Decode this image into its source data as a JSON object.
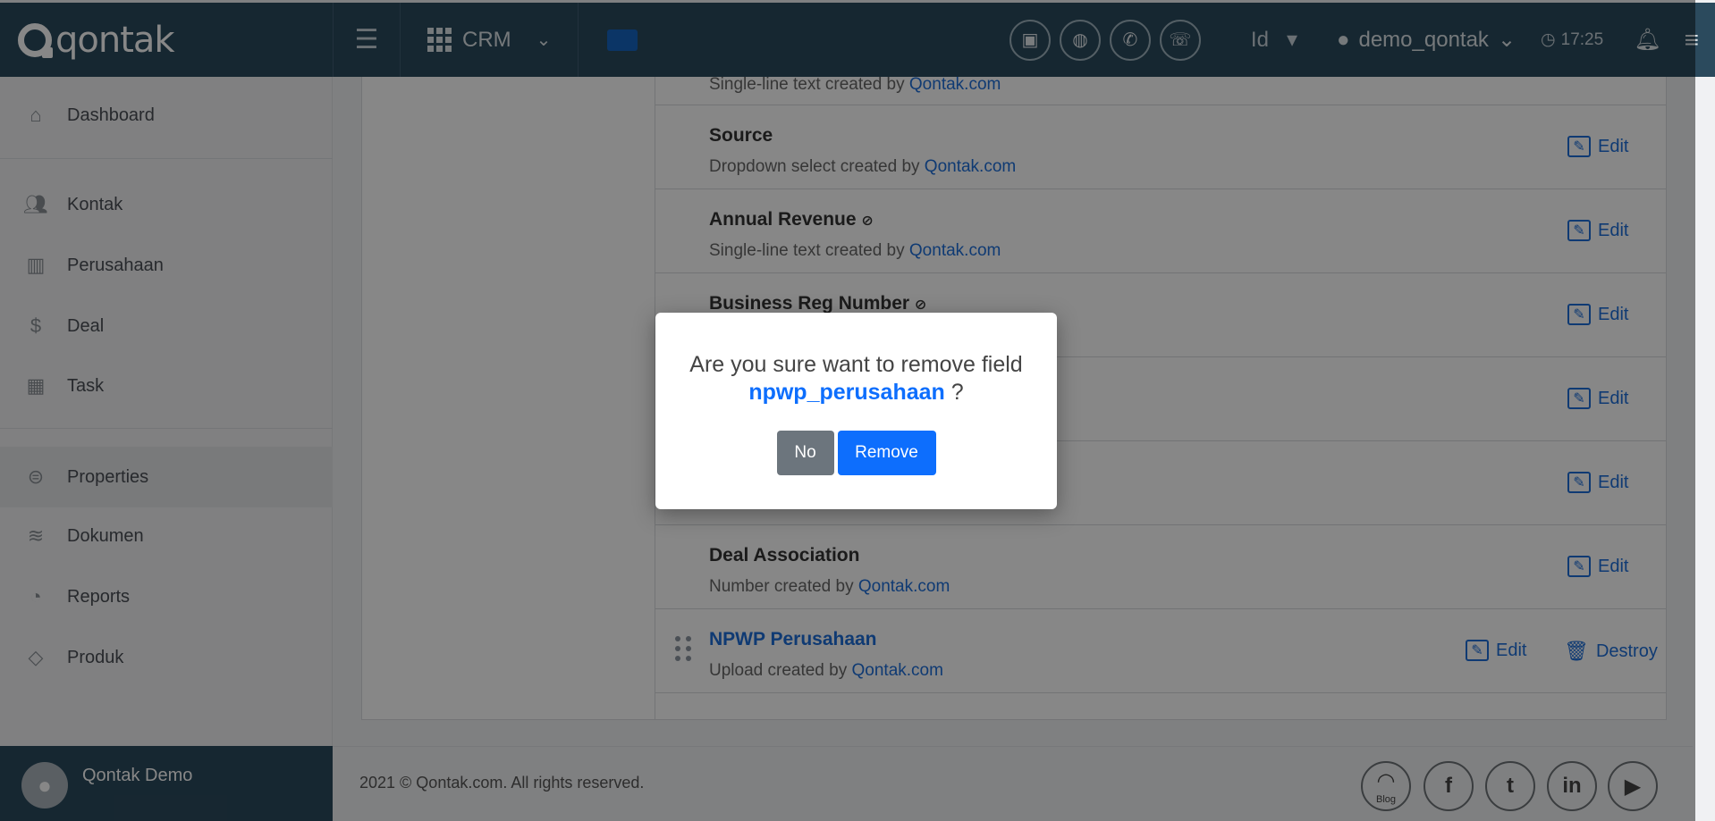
{
  "topbar": {
    "brand": "qontak",
    "module": "CRM",
    "language": "Id",
    "username": "demo_qontak",
    "time": "17:25"
  },
  "sidebar": {
    "items": [
      {
        "label": "Dashboard",
        "icon": "home-icon"
      },
      {
        "label": "Kontak",
        "icon": "users-icon"
      },
      {
        "label": "Perusahaan",
        "icon": "building-icon"
      },
      {
        "label": "Deal",
        "icon": "dollar-icon"
      },
      {
        "label": "Task",
        "icon": "calendar-icon"
      },
      {
        "label": "Properties",
        "icon": "list-icon"
      },
      {
        "label": "Dokumen",
        "icon": "layers-icon"
      },
      {
        "label": "Reports",
        "icon": "pie-chart-icon"
      },
      {
        "label": "Produk",
        "icon": "tag-icon"
      }
    ],
    "footer_user": "Qontak Demo"
  },
  "fields": {
    "partial_desc_prefix": "Single-line text created by",
    "rows": [
      {
        "name": "Source",
        "type_prefix": "Dropdown select created by",
        "creator": "Qontak.com",
        "edit": "Edit"
      },
      {
        "name": "Annual Revenue",
        "type_prefix": "Single-line text created by",
        "creator": "Qontak.com",
        "edit": "Edit"
      },
      {
        "name": "Business Reg Number",
        "type_prefix": "",
        "creator": "",
        "edit": "Edit"
      },
      {
        "name": "",
        "type_prefix": "",
        "creator": "",
        "edit": "Edit"
      },
      {
        "name": "",
        "type_prefix": "",
        "creator": "",
        "edit": "Edit"
      },
      {
        "name": "Deal Association",
        "type_prefix": "Number created by",
        "creator": "Qontak.com",
        "edit": "Edit"
      },
      {
        "name": "NPWP Perusahaan",
        "type_prefix": "Upload created by",
        "creator": "Qontak.com",
        "edit": "Edit",
        "destroy": "Destroy"
      }
    ],
    "creator_link": "Qontak.com"
  },
  "footer": {
    "copyright": "2021 © Qontak.com. All rights reserved.",
    "blog_label": "Blog"
  },
  "modal": {
    "question": "Are you sure want to remove field",
    "field_key": "npwp_perusahaan",
    "suffix": " ?",
    "no_label": "No",
    "remove_label": "Remove"
  }
}
